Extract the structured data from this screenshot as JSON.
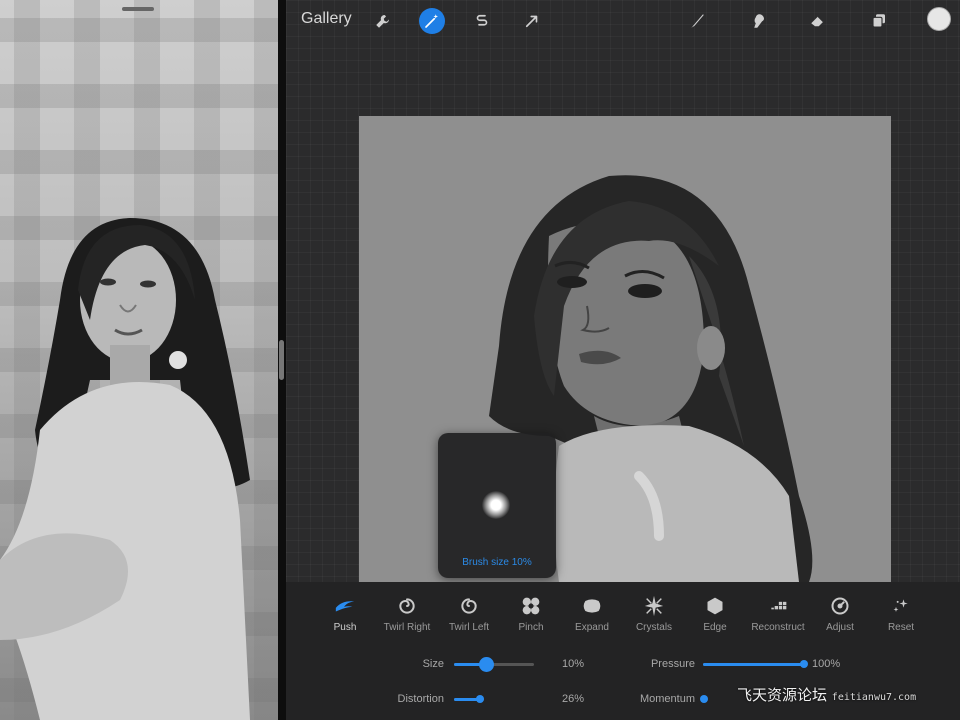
{
  "toolbar": {
    "gallery_label": "Gallery",
    "tools_left": [
      "wrench-icon",
      "magic-wand-icon",
      "selection-s-icon",
      "transform-arrow-icon"
    ],
    "active_tool": "magic-wand-icon",
    "tools_right": [
      "brush-icon",
      "smudge-icon",
      "eraser-icon",
      "layers-icon"
    ],
    "accent_color": "#1f7fe6",
    "current_color": "#e6e6e6"
  },
  "brush_popup": {
    "label": "Brush size 10%"
  },
  "liquify": {
    "modes": [
      {
        "label": "Push",
        "icon": "push-icon",
        "active": true
      },
      {
        "label": "Twirl Right",
        "icon": "twirl-right-icon",
        "active": false
      },
      {
        "label": "Twirl Left",
        "icon": "twirl-left-icon",
        "active": false
      },
      {
        "label": "Pinch",
        "icon": "pinch-icon",
        "active": false
      },
      {
        "label": "Expand",
        "icon": "expand-icon",
        "active": false
      },
      {
        "label": "Crystals",
        "icon": "crystals-icon",
        "active": false
      },
      {
        "label": "Edge",
        "icon": "edge-icon",
        "active": false
      },
      {
        "label": "Reconstruct",
        "icon": "reconstruct-icon",
        "active": false
      },
      {
        "label": "Adjust",
        "icon": "adjust-icon",
        "active": false
      },
      {
        "label": "Reset",
        "icon": "reset-sparkle-icon",
        "active": false
      }
    ],
    "params": {
      "size": {
        "label": "Size",
        "value": "10%",
        "level": 0.25
      },
      "pressure": {
        "label": "Pressure",
        "value": "100%",
        "level": 1.0
      },
      "distortion": {
        "label": "Distortion",
        "value": "26%",
        "level": 0.26
      },
      "momentum": {
        "label": "Momentum",
        "value": "",
        "level": 0.0
      }
    }
  },
  "watermark": {
    "text": "飞天资源论坛",
    "domain": "feitianwu7.com"
  }
}
